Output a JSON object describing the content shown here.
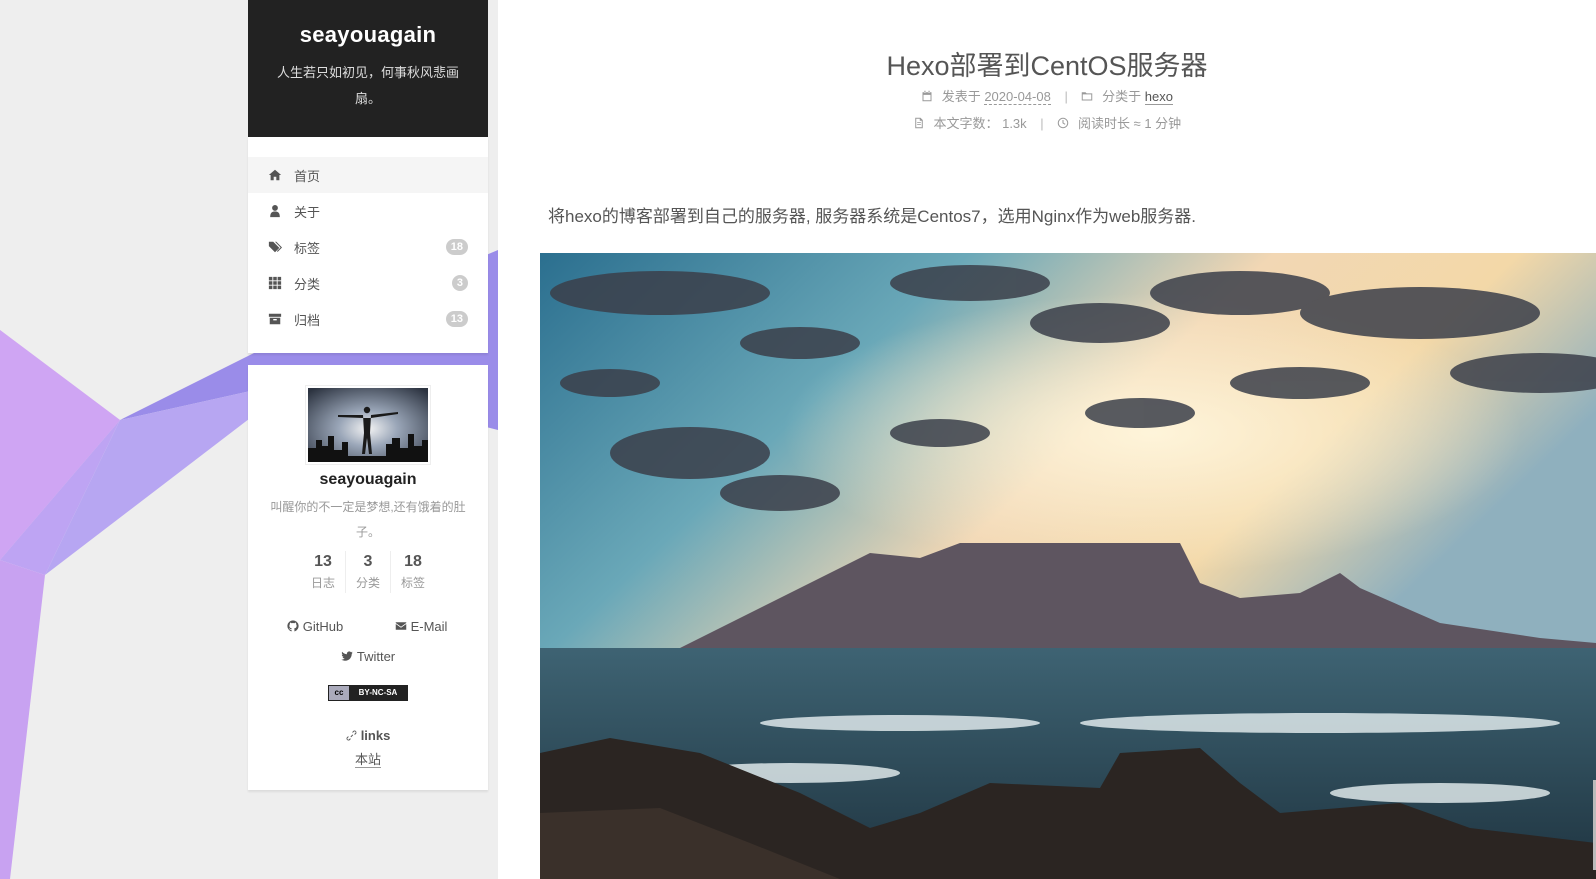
{
  "site": {
    "title": "seayouagain",
    "subtitle": "人生若只如初见，何事秋风悲画扇。"
  },
  "menu": [
    {
      "label": "首页",
      "icon": "home-icon",
      "badge": ""
    },
    {
      "label": "关于",
      "icon": "user-icon",
      "badge": ""
    },
    {
      "label": "标签",
      "icon": "tags-icon",
      "badge": "18"
    },
    {
      "label": "分类",
      "icon": "th-icon",
      "badge": "3"
    },
    {
      "label": "归档",
      "icon": "archive-icon",
      "badge": "13"
    }
  ],
  "author": {
    "name": "seayouagain",
    "description": "叫醒你的不一定是梦想,还有饿着的肚子。"
  },
  "stats": [
    {
      "count": "13",
      "label": "日志"
    },
    {
      "count": "3",
      "label": "分类"
    },
    {
      "count": "18",
      "label": "标签"
    }
  ],
  "social": {
    "github": "GitHub",
    "email": "E-Mail",
    "twitter": "Twitter"
  },
  "license": {
    "badge_text": "BY-NC-SA"
  },
  "links": {
    "title": "links",
    "items": [
      "本站"
    ]
  },
  "post": {
    "title": "Hexo部署到CentOS服务器",
    "posted_label": "发表于",
    "date": "2020-04-08",
    "category_label": "分类于",
    "category": "hexo",
    "wordcount_label": "本文字数：",
    "wordcount": "1.3k",
    "readtime_label": "阅读时长 ≈",
    "readtime": "1 分钟",
    "body": "将hexo的博客部署到自己的服务器, 服务器系统是Centos7，选用Nginx作为web服务器."
  },
  "colors": {
    "brand_bg": "#222222",
    "page_bg": "#eeeeee",
    "poly_purple": "#9c8ee8",
    "poly_pink": "#c9a0f0"
  }
}
